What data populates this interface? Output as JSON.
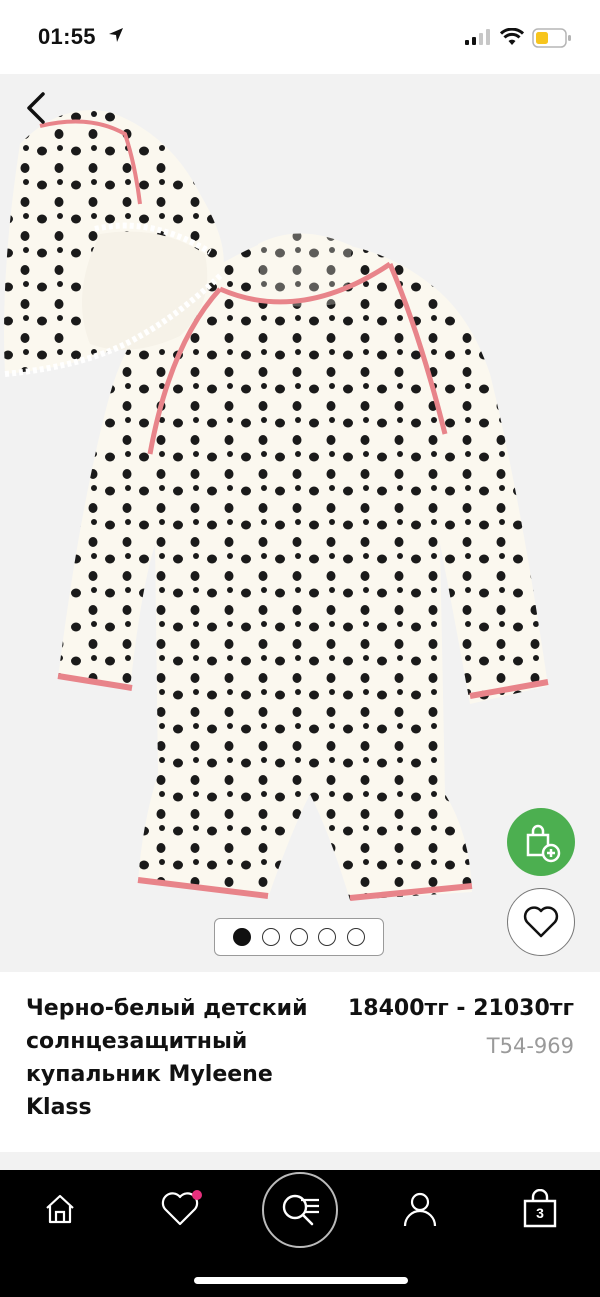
{
  "status": {
    "time": "01:55"
  },
  "product": {
    "title": "Черно-белый детский солнцезащитный купальник Myleene Klass",
    "price": "18400тг - 21030тг",
    "sku": "T54-969"
  },
  "gallery": {
    "page_count": 5,
    "active_page": 1
  },
  "tabbar": {
    "cart_count": "3"
  },
  "colors": {
    "accent_green": "#4caf50",
    "badge_pink": "#e6307d",
    "trim_pink": "#e8848a"
  }
}
